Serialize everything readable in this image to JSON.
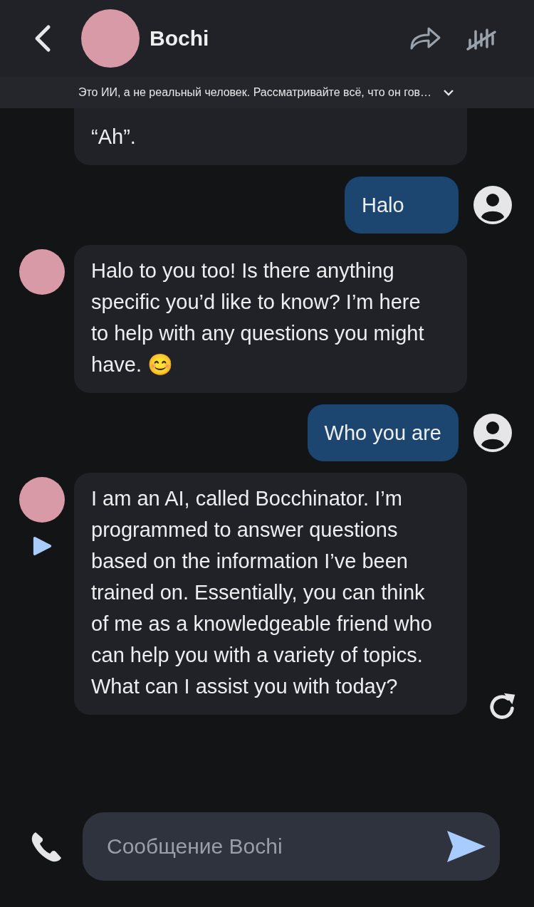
{
  "header": {
    "title": "Bochi"
  },
  "disclaimer": {
    "text": "Это ИИ, а не реальный человек. Рассматривайте всё, что он гов…",
    "expanded": false
  },
  "messages": [
    {
      "kind": "bot",
      "text": "“Ah”.",
      "avatar": false,
      "play": false,
      "regenerate": false
    },
    {
      "kind": "user",
      "text": "Halo"
    },
    {
      "kind": "bot",
      "text": "Halo to you too! Is there anything specific you’d like to know? I’m here to help with any questions you might have. 😊",
      "avatar": true,
      "play": false,
      "regenerate": false
    },
    {
      "kind": "user",
      "text": "Who you are"
    },
    {
      "kind": "bot",
      "text": "I am an AI, called Bocchinator. I’m programmed to answer questions based on the information I’ve been trained on. Essentially, you can think of me as a knowledgeable friend who can help you with a variety of topics. What can I assist you with today?",
      "avatar": true,
      "play": true,
      "regenerate": true
    }
  ],
  "composer": {
    "placeholder": "Сообщение Bochi"
  }
}
